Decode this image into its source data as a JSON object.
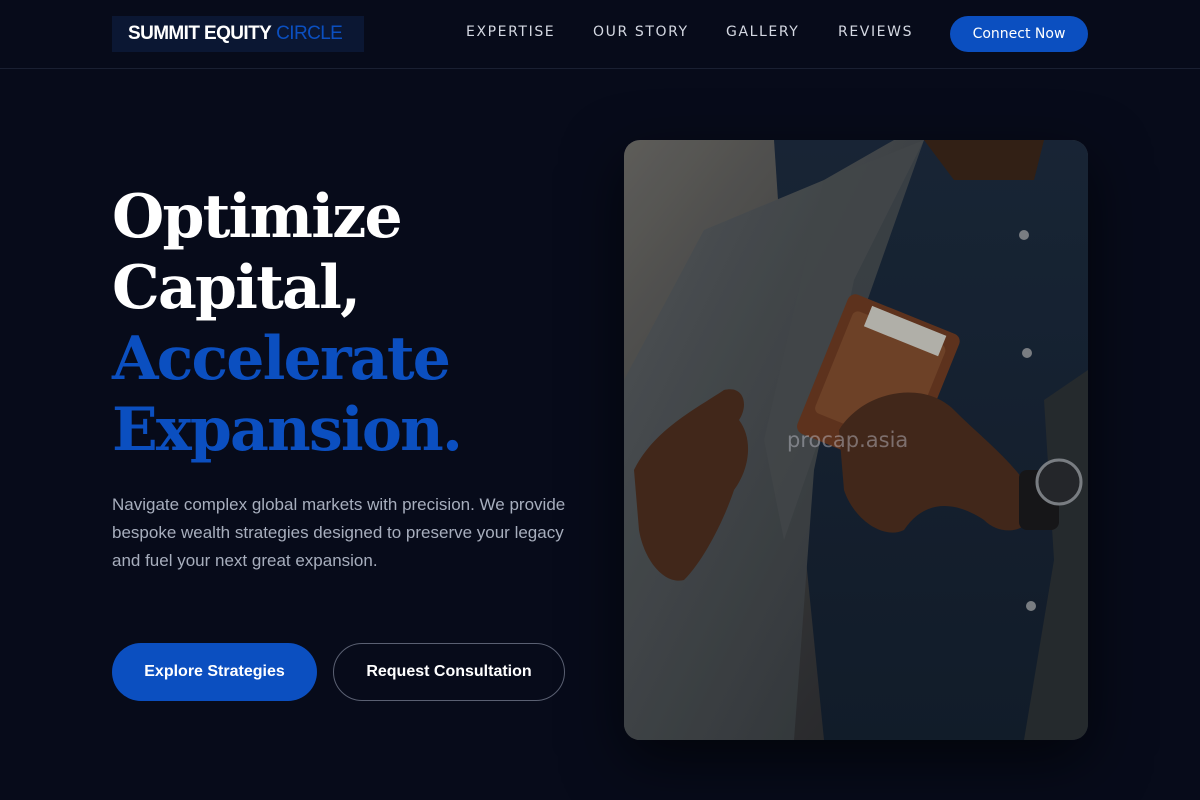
{
  "header": {
    "logo_primary": "SUMMIT EQUITY",
    "logo_accent": "CIRCLE",
    "nav": [
      "EXPERTISE",
      "OUR STORY",
      "GALLERY",
      "REVIEWS"
    ],
    "cta_label": "Connect Now"
  },
  "hero": {
    "headline_lines_white": [
      "Optimize",
      "Capital,"
    ],
    "headline_lines_blue": [
      "Accelerate",
      "Expansion."
    ],
    "subtext": "Navigate complex global markets with precision. We provide bespoke wealth strategies designed to preserve your legacy and fuel your next great expansion.",
    "primary_button": "Explore Strategies",
    "secondary_button": "Request Consultation",
    "watermark": "procap.asia"
  },
  "colors": {
    "background": "#070b1a",
    "accent": "#0b4fc0",
    "muted_text": "#a7aebd"
  }
}
